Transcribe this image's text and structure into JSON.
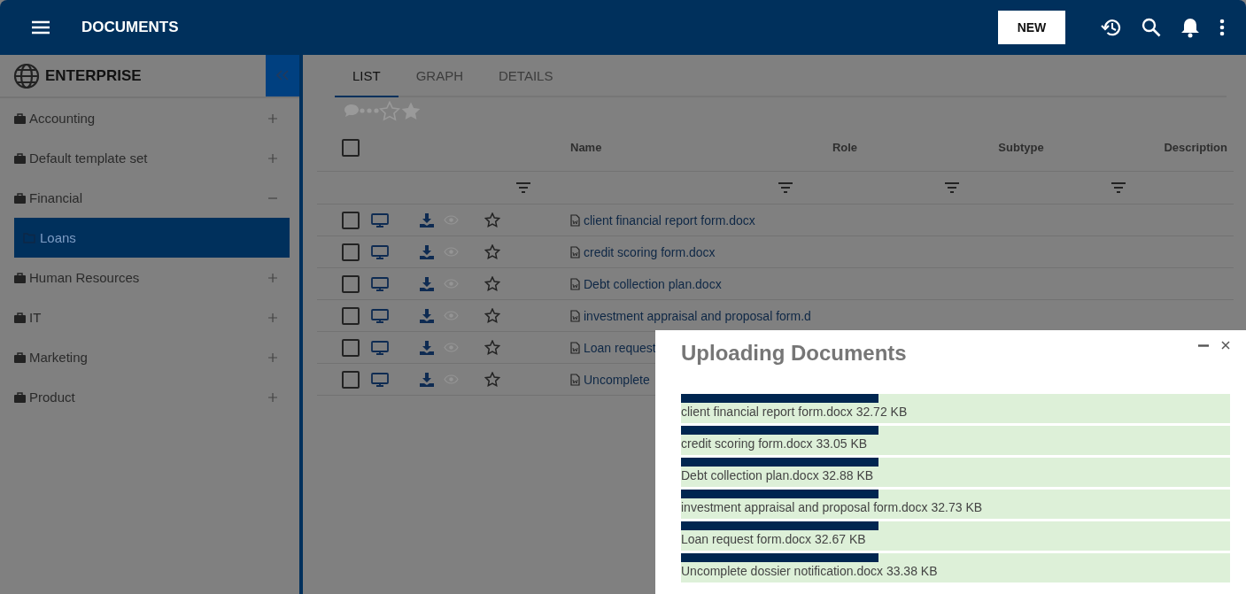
{
  "app_bar": {
    "title": "DOCUMENTS",
    "new_button": "NEW"
  },
  "sidebar": {
    "title": "ENTERPRISE",
    "items": [
      {
        "label": "Accounting",
        "expanded": false,
        "selected": false
      },
      {
        "label": "Default template set",
        "expanded": false,
        "selected": false
      },
      {
        "label": "Financial",
        "expanded": true,
        "selected": false,
        "children": [
          {
            "label": "Loans",
            "selected": true
          }
        ]
      },
      {
        "label": "Human Resources",
        "expanded": false,
        "selected": false
      },
      {
        "label": "IT",
        "expanded": false,
        "selected": false
      },
      {
        "label": "Marketing",
        "expanded": false,
        "selected": false
      },
      {
        "label": "Product",
        "expanded": false,
        "selected": false
      }
    ]
  },
  "tabs": [
    {
      "label": "LIST",
      "selected": true
    },
    {
      "label": "GRAPH",
      "selected": false
    },
    {
      "label": "DETAILS",
      "selected": false
    }
  ],
  "table": {
    "columns": [
      "Name",
      "Role",
      "Subtype",
      "Description"
    ],
    "header_checked": false,
    "rows": [
      {
        "name": "client financial report form.docx",
        "checked": false
      },
      {
        "name": "credit scoring form.docx",
        "checked": false
      },
      {
        "name": "Debt collection plan.docx",
        "checked": false
      },
      {
        "name": "investment appraisal and proposal form.d",
        "checked": false
      },
      {
        "name": "Loan request",
        "checked": false
      },
      {
        "name": "Uncomplete",
        "checked": false
      }
    ]
  },
  "upload_dialog": {
    "title": "Uploading Documents",
    "uploads": [
      {
        "name": "client financial report form.docx 32.72 KB",
        "level": 0.36
      },
      {
        "name": "credit scoring form.docx 33.05 KB",
        "level": 0.36
      },
      {
        "name": "Debt collection plan.docx 32.88 KB",
        "level": 0.36
      },
      {
        "name": "investment appraisal and proposal form.docx 32.73 KB",
        "level": 0.36
      },
      {
        "name": "Loan request form.docx 32.67 KB",
        "level": 0.36
      },
      {
        "name": "Uncomplete dossier notification.docx 33.38 KB",
        "level": 0.36
      }
    ]
  }
}
